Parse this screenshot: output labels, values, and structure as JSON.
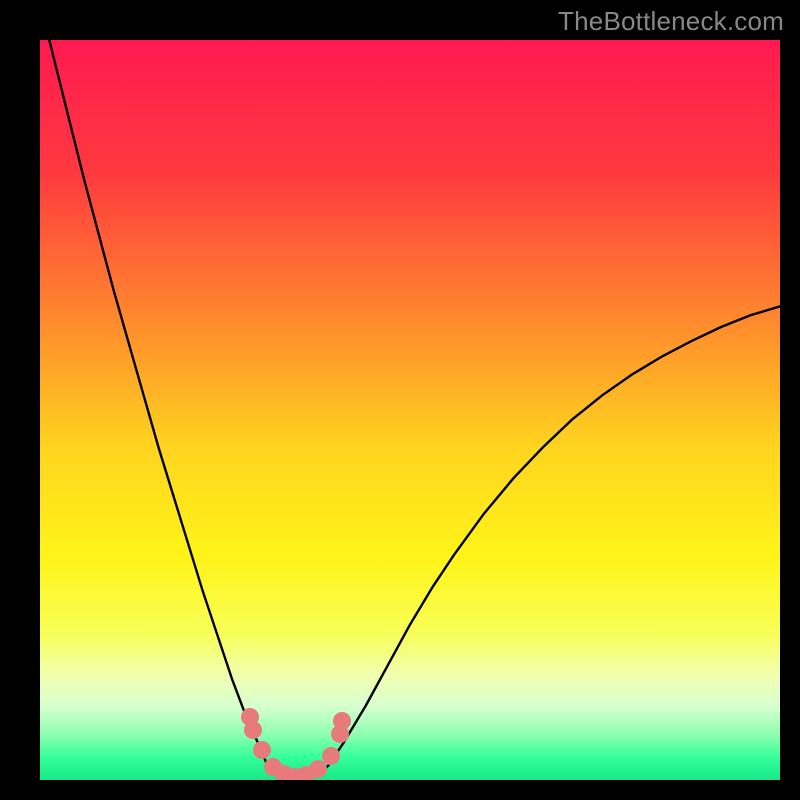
{
  "watermark": "TheBottleneck.com",
  "chart_data": {
    "type": "line",
    "title": "",
    "xlabel": "",
    "ylabel": "",
    "xlim": [
      0,
      1
    ],
    "ylim": [
      0,
      1
    ],
    "gradient_stops": [
      {
        "pos": 0.0,
        "color": "#ff1a51"
      },
      {
        "pos": 0.18,
        "color": "#ff3a3f"
      },
      {
        "pos": 0.38,
        "color": "#ff8a2e"
      },
      {
        "pos": 0.55,
        "color": "#ffd41f"
      },
      {
        "pos": 0.7,
        "color": "#fff419"
      },
      {
        "pos": 0.8,
        "color": "#f8ff56"
      },
      {
        "pos": 0.86,
        "color": "#f0ffb0"
      },
      {
        "pos": 0.9,
        "color": "#d8ffd0"
      },
      {
        "pos": 0.94,
        "color": "#8affb0"
      },
      {
        "pos": 0.97,
        "color": "#33ff99"
      },
      {
        "pos": 1.0,
        "color": "#19e88a"
      }
    ],
    "series": [
      {
        "name": "left-branch",
        "x": [
          0.0,
          0.02,
          0.04,
          0.06,
          0.08,
          0.1,
          0.12,
          0.14,
          0.16,
          0.18,
          0.2,
          0.22,
          0.24,
          0.26,
          0.28,
          0.3,
          0.307
        ],
        "y": [
          1.05,
          0.97,
          0.89,
          0.81,
          0.735,
          0.66,
          0.59,
          0.52,
          0.45,
          0.385,
          0.32,
          0.255,
          0.195,
          0.135,
          0.082,
          0.038,
          0.02
        ]
      },
      {
        "name": "trough",
        "x": [
          0.307,
          0.32,
          0.335,
          0.35,
          0.365,
          0.38,
          0.39
        ],
        "y": [
          0.02,
          0.01,
          0.004,
          0.002,
          0.004,
          0.01,
          0.02
        ]
      },
      {
        "name": "right-branch",
        "x": [
          0.39,
          0.41,
          0.44,
          0.47,
          0.5,
          0.53,
          0.56,
          0.6,
          0.64,
          0.68,
          0.72,
          0.76,
          0.8,
          0.84,
          0.88,
          0.92,
          0.96,
          1.0
        ],
        "y": [
          0.02,
          0.05,
          0.1,
          0.155,
          0.21,
          0.26,
          0.305,
          0.36,
          0.408,
          0.45,
          0.488,
          0.52,
          0.548,
          0.572,
          0.593,
          0.612,
          0.628,
          0.64
        ]
      }
    ],
    "markers": {
      "color": "#e77b7b",
      "points": [
        {
          "x": 0.284,
          "y": 0.085
        },
        {
          "x": 0.288,
          "y": 0.067
        },
        {
          "x": 0.3,
          "y": 0.04
        },
        {
          "x": 0.315,
          "y": 0.018
        },
        {
          "x": 0.33,
          "y": 0.008
        },
        {
          "x": 0.345,
          "y": 0.004
        },
        {
          "x": 0.36,
          "y": 0.007
        },
        {
          "x": 0.375,
          "y": 0.015
        },
        {
          "x": 0.393,
          "y": 0.033
        },
        {
          "x": 0.405,
          "y": 0.062
        },
        {
          "x": 0.408,
          "y": 0.08
        }
      ]
    }
  }
}
